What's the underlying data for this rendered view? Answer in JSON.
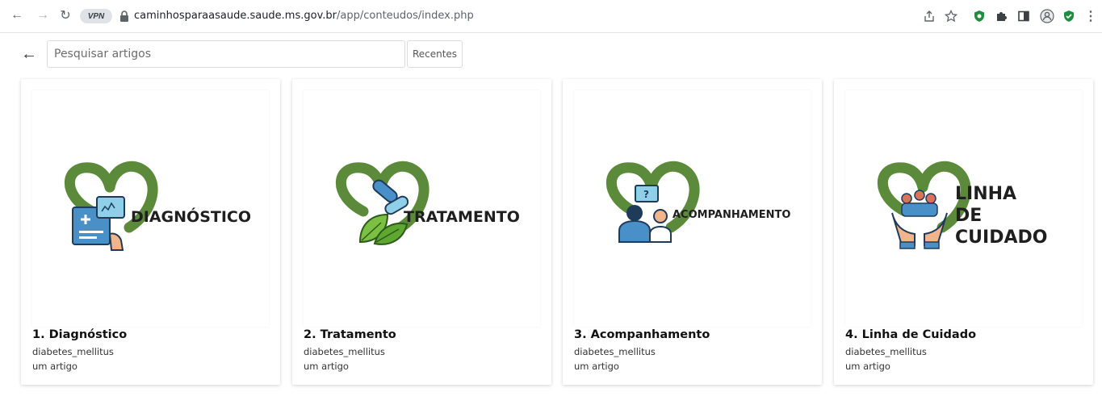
{
  "browser": {
    "vpn_label": "VPN",
    "url_host": "caminhosparaasaude.saude.ms.gov.br",
    "url_path": "/app/conteudos/index.php"
  },
  "toolbar": {
    "search_placeholder": "Pesquisar artigos",
    "recent_label": "Recentes"
  },
  "cards": [
    {
      "logo_text": "DIAGNÓSTICO",
      "title": "1. Diagnóstico",
      "tag": "diabetes_mellitus",
      "count": "um artigo"
    },
    {
      "logo_text": "TRATAMENTO",
      "title": "2. Tratamento",
      "tag": "diabetes_mellitus",
      "count": "um artigo"
    },
    {
      "logo_text": "ACOMPANHAMENTO",
      "title": "3. Acompanhamento",
      "tag": "diabetes_mellitus",
      "count": "um artigo"
    },
    {
      "logo_text_lines": [
        "LINHA",
        "DE",
        "CUIDADO"
      ],
      "title": "4. Linha de Cuidado",
      "tag": "diabetes_mellitus",
      "count": "um artigo"
    }
  ],
  "colors": {
    "logo_green": "#5b8a3a",
    "icon_blue": "#4a90c8",
    "ext_green": "#1e8e3e"
  }
}
